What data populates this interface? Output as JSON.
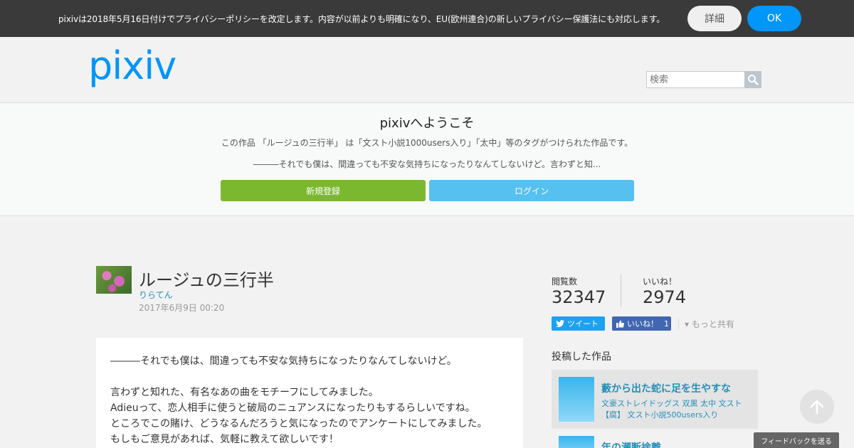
{
  "banner": {
    "text": "pixivは2018年5月16日付けでプライバシーポリシーを改定します。内容が以前よりも明確になり、EU(欧州連合)の新しいプライバシー保護法にも対応します。",
    "detail_label": "詳細",
    "ok_label": "OK"
  },
  "header": {
    "logo": "pixiv",
    "search_placeholder": "検索",
    "search_icon": "search-icon"
  },
  "welcome": {
    "title": "pixivへようこそ",
    "description": "この作品 「ルージュの三行半」 は「文スト小説1000users入り」「太中」等のタグがつけられた作品です。",
    "excerpt": "―――それでも僕は、間違っても不安な気持ちになったりなんてしないけど。言わずと知...",
    "signup_label": "新規登録",
    "login_label": "ログイン"
  },
  "work": {
    "title": "ルージュの三行半",
    "author": "りらてん",
    "date": "2017年6月9日 00:20",
    "text_lines": [
      "―――それでも僕は、間違っても不安な気持ちになったりなんてしないけど。",
      "",
      "言わずと知れた、有名なあの曲をモチーフにしてみました。",
      "Adieuって、恋人相手に使うと破局のニュアンスになったりもするらしいですね。",
      "ところでこの賭け、どうなるんだろうと気になったのでアンケートにしてみました。",
      "もしもご意見があれば、気軽に教えて欲しいです！"
    ]
  },
  "stats": {
    "views_label": "閲覧数",
    "views_value": "32347",
    "likes_label": "いいね！",
    "likes_value": "2974"
  },
  "share": {
    "tweet_label": "ツイート",
    "like_label": "いいね！",
    "like_count": "1",
    "more_label": "▾ もっと共有"
  },
  "posted": {
    "heading": "投稿した作品",
    "items": [
      {
        "title": "藪から出た蛇に足を生やすな",
        "tags": "文豪ストレイドッグス 双黒 太中 文スト【腐】 文スト小説500users入り"
      },
      {
        "title": "年の瀬断捨離"
      }
    ]
  },
  "footer": {
    "feedback_label": "フィードバックを送る"
  },
  "colors": {
    "brand": "#0096fa",
    "signup": "#7cb82f",
    "login": "#56c0f0",
    "link": "#258fb8"
  }
}
